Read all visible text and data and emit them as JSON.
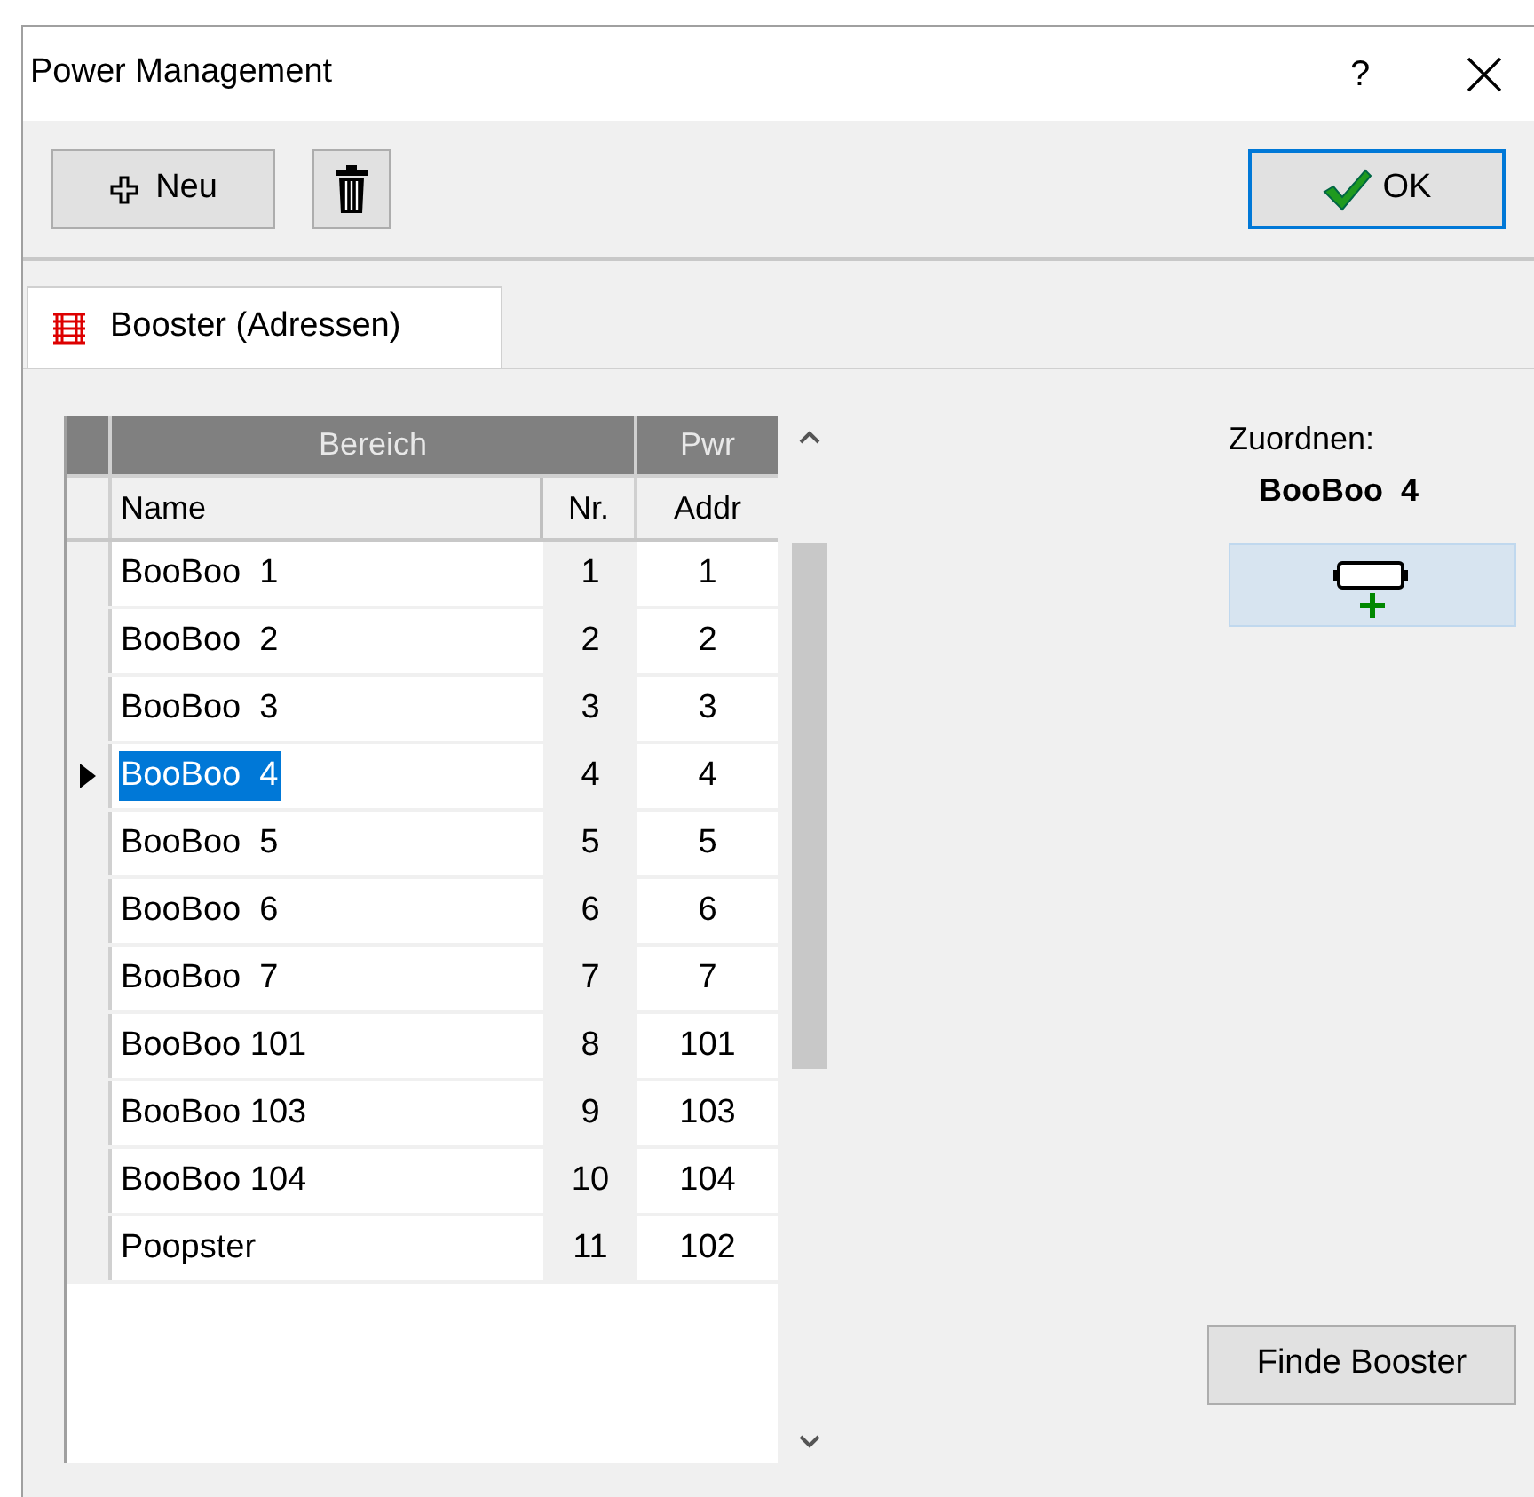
{
  "window": {
    "title": "Power Management",
    "help": "?"
  },
  "toolbar": {
    "new_button": "Neu",
    "ok_button": "OK"
  },
  "tabs": [
    {
      "label": "Booster (Adressen)",
      "selected": true
    }
  ],
  "table": {
    "group_headers": [
      "Bereich",
      "Pwr"
    ],
    "columns": [
      "Name",
      "Nr.",
      "Addr"
    ],
    "rows": [
      {
        "name": "BooBoo  1",
        "nr": "1",
        "addr": "1",
        "selected": false
      },
      {
        "name": "BooBoo  2",
        "nr": "2",
        "addr": "2",
        "selected": false
      },
      {
        "name": "BooBoo  3",
        "nr": "3",
        "addr": "3",
        "selected": false
      },
      {
        "name": "BooBoo  4",
        "nr": "4",
        "addr": "4",
        "selected": true
      },
      {
        "name": "BooBoo  5",
        "nr": "5",
        "addr": "5",
        "selected": false
      },
      {
        "name": "BooBoo  6",
        "nr": "6",
        "addr": "6",
        "selected": false
      },
      {
        "name": "BooBoo  7",
        "nr": "7",
        "addr": "7",
        "selected": false
      },
      {
        "name": "BooBoo 101",
        "nr": "8",
        "addr": "101",
        "selected": false
      },
      {
        "name": "BooBoo 103",
        "nr": "9",
        "addr": "103",
        "selected": false
      },
      {
        "name": "BooBoo 104",
        "nr": "10",
        "addr": "104",
        "selected": false
      },
      {
        "name": "Poopster",
        "nr": "11",
        "addr": "102",
        "selected": false
      }
    ]
  },
  "assign": {
    "label": "Zuordnen:",
    "target": "BooBoo  4"
  },
  "find_button": "Finde Booster"
}
